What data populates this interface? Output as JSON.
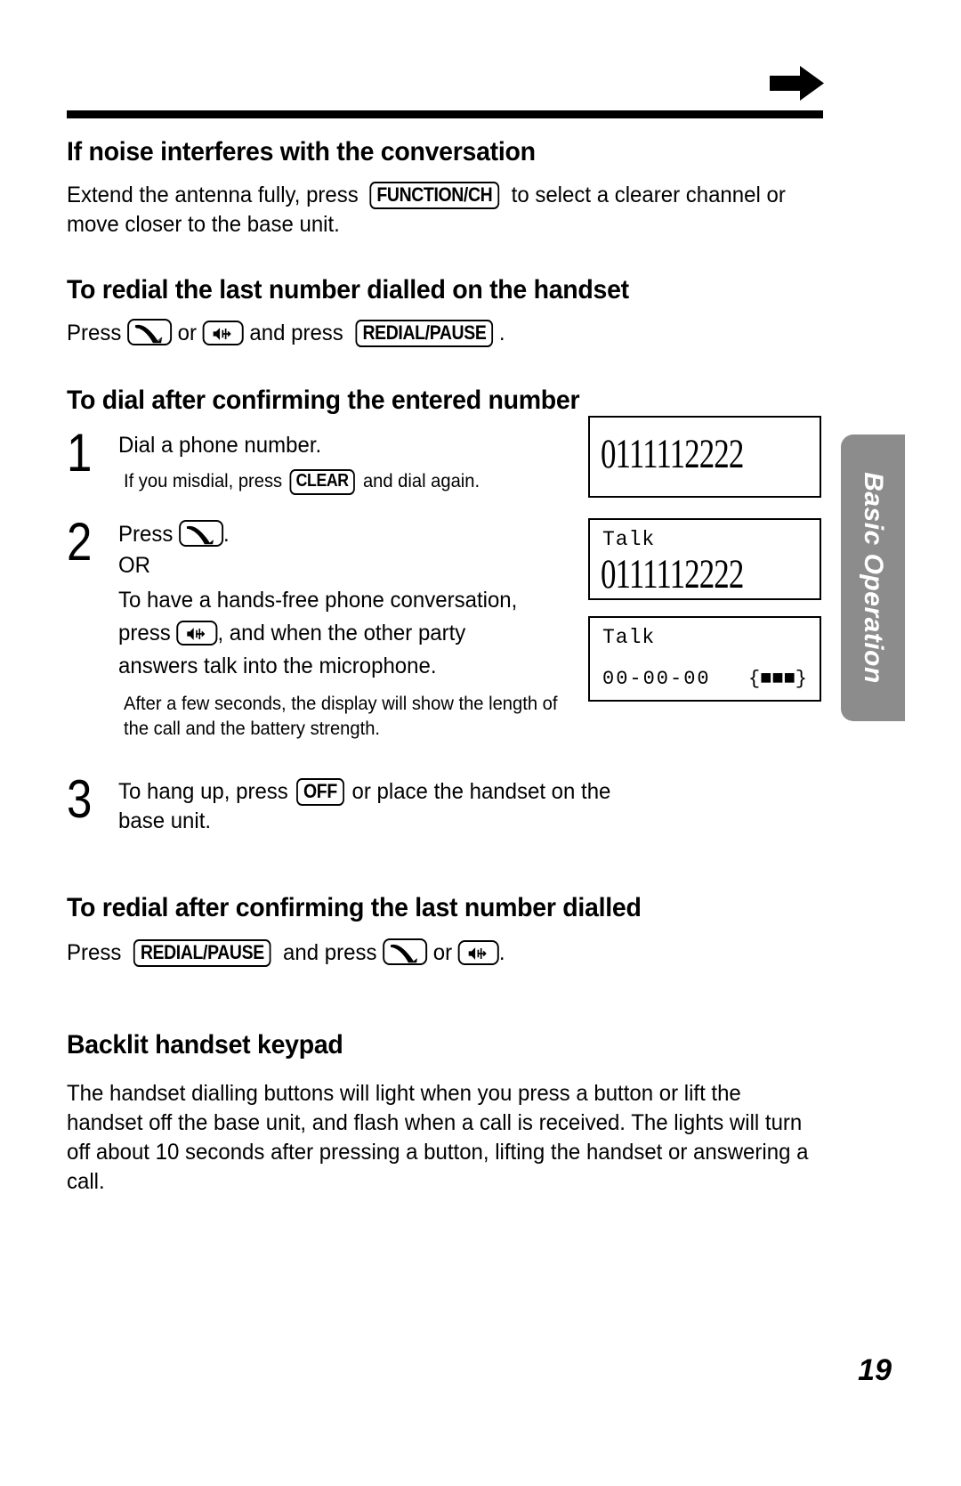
{
  "page": {
    "number": "19",
    "side_tab_label": "Basic Operation"
  },
  "sections": {
    "noise": {
      "heading": "If noise interferes with the conversation",
      "body_before": "Extend the antenna fully, press",
      "key_function_ch": "FUNCTION/CH",
      "body_after": "to select a clearer channel or move closer to the base unit."
    },
    "redial_handset": {
      "heading": "To redial the last number dialled on the handset",
      "press_label": "Press",
      "or_label": "or",
      "and_press_label": "and press",
      "key_redial_pause": "REDIAL/PAUSE",
      "period": "."
    },
    "dial_confirm": {
      "heading": "To dial after confirming the entered number",
      "steps": [
        {
          "number": "1",
          "line1": "Dial a phone number.",
          "note_before": "If you misdial, press",
          "key": "CLEAR",
          "note_after": "and dial again."
        },
        {
          "number": "2",
          "press_label": "Press",
          "press_period": ".",
          "or_label": "OR",
          "line_handsfree": "To have a hands-free phone conversation,",
          "press2_label": "press",
          "press2_after": ", and when the other party",
          "line_answers": "answers talk into the microphone.",
          "note": "After a few seconds, the display will show the length of the call and the battery strength."
        },
        {
          "number": "3",
          "text_before": "To hang up, press",
          "key": "OFF",
          "text_after": "or place the handset on the base unit."
        }
      ],
      "lcd_displays": [
        {
          "name": "lcd-number-entry",
          "number": "0111112222"
        },
        {
          "name": "lcd-talk-number",
          "status": "Talk",
          "number": "0111112222"
        },
        {
          "name": "lcd-talk-timer",
          "status": "Talk",
          "time": "00-00-00",
          "battery": "{■■■}"
        }
      ]
    },
    "redial_confirm": {
      "heading": "To redial after confirming the last number dialled",
      "press_label": "Press",
      "key_redial_pause": "REDIAL/PAUSE",
      "and_press_label": "and press",
      "or_label": "or",
      "period": "."
    },
    "backlit": {
      "heading": "Backlit handset keypad",
      "body": "The handset dialling buttons will light when you press a button or lift the handset off the base unit, and flash when a call is received. The lights will turn off about 10 seconds after pressing a button, lifting the handset or answering a call."
    }
  },
  "icons": {
    "talk_handset": "handset-icon",
    "speakerphone": "speaker-icon",
    "header_arrow": "right-arrow-icon"
  }
}
